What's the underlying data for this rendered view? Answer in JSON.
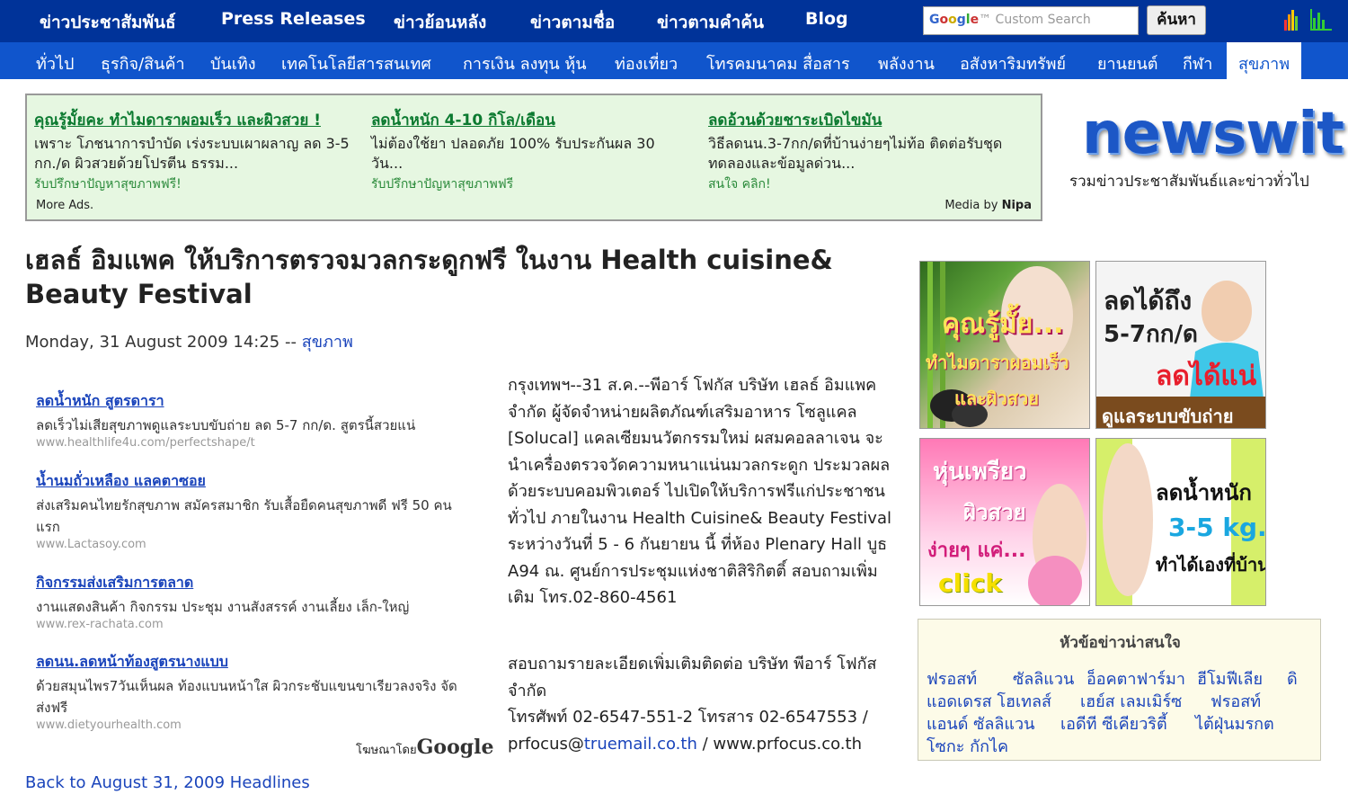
{
  "topnav": {
    "items": [
      "ข่าวประชาสัมพันธ์",
      "Press Releases",
      "ข่าวย้อนหลัง",
      "ข่าวตามชื่อ",
      "ข่าวตามคำค้น",
      "Blog"
    ],
    "search_placeholder": "Custom Search",
    "search_button": "ค้นหา"
  },
  "catnav": {
    "items": [
      "ทั่วไป",
      "ธุรกิจ/สินค้า",
      "บันเทิง",
      "เทคโนโลยีสารสนเทศ",
      "การเงิน ลงทุน หุ้น",
      "ท่องเที่ยว",
      "โทรคมนาคม สื่อสาร",
      "พลังงาน",
      "อสังหาริมทรัพย์",
      "ยานยนต์",
      "กีฬา",
      "สุขภาพ"
    ],
    "active": "สุขภาพ"
  },
  "top_ads": [
    {
      "title": "คุณรู้มั้ยคะ ทำไมดาราผอมเร็ว และผิวสวย !",
      "desc": "เพราะ โภชนาการบำบัด เร่งระบบเผาผลาญ ลด 3-5 กก./ด ผิวสวยด้วยโปรตีน ธรรม...",
      "sub": "รับปรึกษาปัญหาสุขภาพฟรี!"
    },
    {
      "title": "ลดน้ำหนัก 4-10 กิโล/เดือน",
      "desc": "ไม่ต้องใช้ยา ปลอดภัย 100% รับประกันผล 30 วัน...",
      "sub": "รับปรึกษาปัญหาสุขภาพฟรี"
    },
    {
      "title": "ลดอ้วนด้วยชาระเบิดไขมัน",
      "desc": "วิธีลดนน.3-7กก/ดที่บ้านง่ายๆไม่ท้อ ติดต่อรับชุดทดลองและข้อมูลด่วน...",
      "sub": "สนใจ คลิก!"
    }
  ],
  "ad_footer": {
    "more": "More Ads.",
    "media_prefix": "Media by",
    "media_brand": "Nipa"
  },
  "logo": {
    "text": "newswit",
    "tagline": "รวมข่าวประชาสัมพันธ์และข่าวทั่วไป"
  },
  "article": {
    "headline": "เฮลธ์ อิมแพค ให้บริการตรวจมวลกระดูกฟรี ในงาน Health cuisine& Beauty Festival",
    "date": "Monday, 31 August 2009 14:25 --",
    "category": "สุขภาพ",
    "para1": "กรุงเทพฯ--31 ส.ค.--พีอาร์ โฟกัส บริษัท เฮลธ์ อิมแพค จำกัด ผู้จัดจำหน่ายผลิตภัณฑ์เสริมอาหาร โซลูแคล [Solucal] แคลเซียมนวัตกรรมใหม่ ผสมคอลลาเจน จะนำเครื่องตรวจวัดความหนาแน่นมวลกระดูก ประมวลผลด้วยระบบคอมพิวเตอร์ ไปเปิดให้บริการฟรีแก่ประชาชนทั่วไป ภายในงาน Health Cuisine& Beauty Festival ระหว่างวันที่ 5 - 6 กันยายน นี้ ที่ห้อง Plenary Hall บูธ A94 ณ. ศูนย์การประชุมแห่งชาติสิริกิตติ์ สอบถามเพิ่มเติม โทร.02-860-4561",
    "para2_a": "สอบถามรายละเอียดเพิ่มเติมติดต่อ บริษัท พีอาร์ โฟกัส จำกัด",
    "para2_b": "โทรศัพท์ 02-6547-551-2 โทรสาร 02-6547553 /",
    "email_prefix": "prfocus@",
    "email_domain": "truemail.co.th",
    "website": " / www.prfocus.co.th",
    "back_link": "Back to August 31, 2009 Headlines"
  },
  "left_ads": [
    {
      "title": "ลดน้ำหนัก สูตรดารา",
      "desc": "ลดเร็วไม่เสียสุขภาพดูแลระบบขับถ่าย ลด 5-7 กก/ด. สูตรนี้สวยแน่",
      "url": "www.healthlife4u.com/perfectshape/t"
    },
    {
      "title": "น้ำนมถั่วเหลือง แลคตาซอย",
      "desc": "ส่งเสริมคนไทยรักสุขภาพ สมัครสมาชิก รับเสื้อยืดคนสุขภาพดี ฟรี 50 คนแรก",
      "url": "www.Lactasoy.com"
    },
    {
      "title": "กิจกรรมส่งเสริมการตลาด",
      "desc": "งานแสดงสินค้า กิจกรรม ประชุม งานสังสรรค์ งานเลี้ยง เล็ก-ใหญ่",
      "url": "www.rex-rachata.com"
    },
    {
      "title": "ลดนน.ลดหน้าท้องสูตรนางแบบ",
      "desc": "ด้วยสมุนไพร7วันเห็นผล ท้องแบนหน้าใส ผิวกระชับแขนขาเรียวลงจริง จัดส่งฟรี",
      "url": "www.dietyourhealth.com"
    }
  ],
  "ads_by": {
    "prefix": "โฆษณาโดย",
    "brand": "Google"
  },
  "banners": [
    {
      "line1": "คุณรู้มั้ย...",
      "line2": "ทำไมดาราผอมเร็ว",
      "line3": "และผิวสวย"
    },
    {
      "line1": "ลดได้ถึง",
      "line2": "5-7กก/ด",
      "line3": "ลดได้แน่",
      "line4": "ดูแลระบบขับถ่าย"
    },
    {
      "line1": "หุ่นเพรียว",
      "line2": "ผิวสวย",
      "line3": "ง่ายๆ แค่...",
      "line4": "click"
    },
    {
      "line1": "ลดน้ำหนัก",
      "line2": "3-5 kg.",
      "line3": "ทำได้เองที่บ้าน"
    }
  ],
  "topics": {
    "title": "หัวข้อข่าวน่าสนใจ",
    "links": [
      "ฟรอสท์",
      "ซัลลิแวน",
      "อ็อคตาฟาร์มา",
      "ฮีโมฟีเลีย",
      "ดิ",
      "แอดเดรส โฮเทลส์",
      "เฮย์ส เลมเมิร์ซ",
      "ฟรอสท์",
      "แอนด์ ซัลลิแวน",
      "เอดีที ซีเคียวริตี้",
      "ไต้ฝุ่นมรกต",
      "โซกะ กักไค"
    ]
  },
  "colors": {
    "topnav": "#003399",
    "catnav": "#1055cc",
    "link": "#1a44bb",
    "ad_green": "#0c7a30",
    "ad_bg": "#e6f7e1"
  }
}
